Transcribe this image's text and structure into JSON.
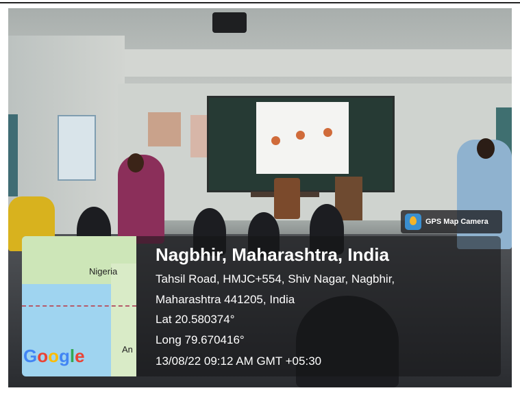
{
  "overlay": {
    "badge_label": "GPS Map Camera",
    "badge_icon": "gps-map-camera-icon",
    "location_title": "Nagbhir, Maharashtra, India",
    "address_line1": "Tahsil Road, HMJC+554, Shiv Nagar, Nagbhir,",
    "address_line2": "Maharashtra 441205, India",
    "latitude": "Lat 20.580374°",
    "longitude": "Long 79.670416°",
    "datetime": "13/08/22 09:12 AM GMT +05:30"
  },
  "map": {
    "label_country": "Nigeria",
    "label_partial": "An",
    "logo_text": "Google"
  },
  "colors": {
    "overlay_bg": "#141416",
    "map_water": "#9fd4f0",
    "text": "#ffffff"
  }
}
